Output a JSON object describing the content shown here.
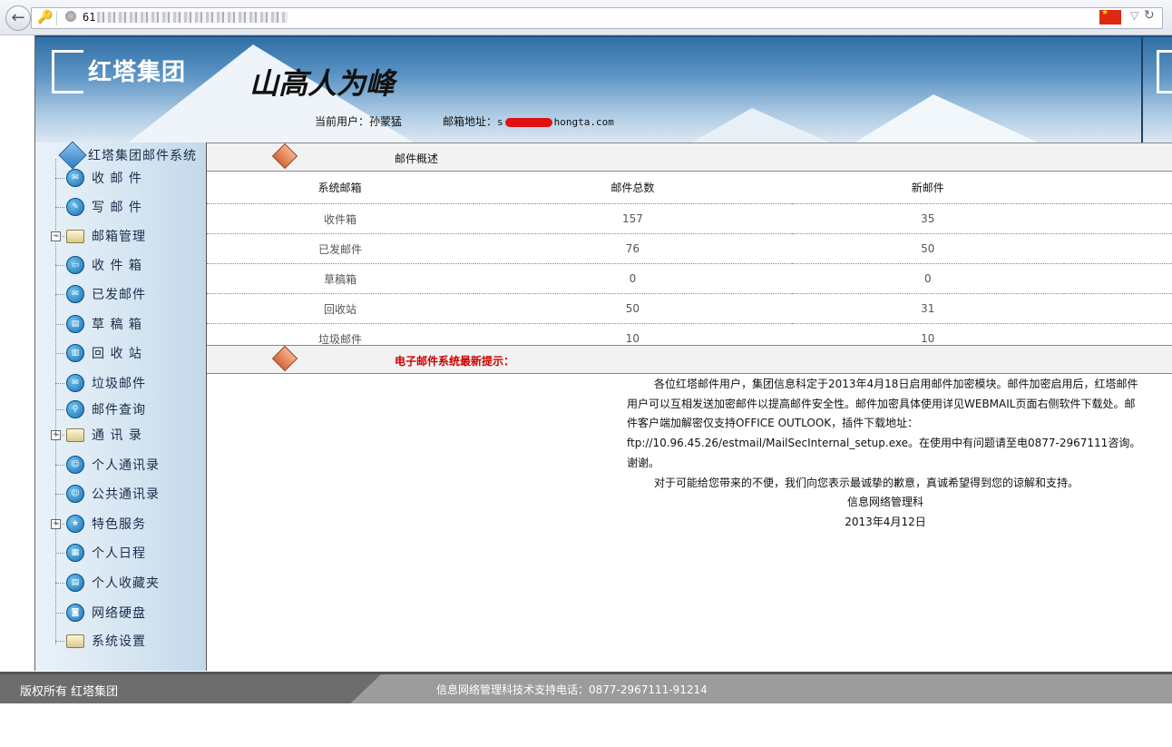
{
  "browser": {
    "back_icon": "back-arrow-icon",
    "url_prefix": "61",
    "flag": "china-flag-icon"
  },
  "header": {
    "logo_text": "红塔集团",
    "slogan": "山高人为峰",
    "current_user_label": "当前用户：",
    "current_user": "孙蒙猛",
    "mail_label": "邮箱地址：",
    "mail_prefix": "s",
    "mail_domain": "hongta.com"
  },
  "sidebar": {
    "root": "红塔集团邮件系统",
    "items": [
      {
        "label": "收 邮 件",
        "icon": "inbox-icon"
      },
      {
        "label": "写 邮 件",
        "icon": "pencil-icon"
      },
      {
        "label": "邮箱管理",
        "icon": "folder-open-icon"
      },
      {
        "label": "收 件 箱",
        "icon": "inbox-tray-icon"
      },
      {
        "label": "已发邮件",
        "icon": "sent-mail-icon"
      },
      {
        "label": "草 稿 箱",
        "icon": "draft-icon"
      },
      {
        "label": "回 收 站",
        "icon": "trash-icon"
      },
      {
        "label": "垃圾邮件",
        "icon": "spam-icon"
      },
      {
        "label": "邮件查询",
        "icon": "mail-search-icon"
      },
      {
        "label": "通 讯 录",
        "icon": "folder-icon"
      },
      {
        "label": "个人通讯录",
        "icon": "personal-contacts-icon"
      },
      {
        "label": "公共通讯录",
        "icon": "public-contacts-icon"
      },
      {
        "label": "特色服务",
        "icon": "services-icon"
      },
      {
        "label": "个人日程",
        "icon": "calendar-icon"
      },
      {
        "label": "个人收藏夹",
        "icon": "favorites-icon"
      },
      {
        "label": "网络硬盘",
        "icon": "network-disk-icon"
      },
      {
        "label": "系统设置",
        "icon": "settings-folder-icon"
      }
    ]
  },
  "overview": {
    "title": "邮件概述",
    "columns": [
      "系统邮箱",
      "邮件总数",
      "新邮件"
    ],
    "rows": [
      {
        "name": "收件箱",
        "total": "157",
        "new": "35"
      },
      {
        "name": "已发邮件",
        "total": "76",
        "new": "50"
      },
      {
        "name": "草稿箱",
        "total": "0",
        "new": "0"
      },
      {
        "name": "回收站",
        "total": "50",
        "new": "31"
      },
      {
        "name": "垃圾邮件",
        "total": "10",
        "new": "10"
      }
    ]
  },
  "notice": {
    "title": "电子邮件系统最新提示：",
    "para1": "各位红塔邮件用户，集团信息科定于2013年4月18日启用邮件加密模块。邮件加密启用后，红塔邮件用户可以互相发送加密邮件以提高邮件安全性。邮件加密具体使用详见WEBMAIL页面右侧软件下载处。邮件客户端加解密仅支持OFFICE OUTLOOK，插件下载地址：ftp://10.96.45.26/estmail/MailSecInternal_setup.exe。在使用中有问题请至电0877-2967111咨询。谢谢。",
    "para2": "对于可能给您带来的不便，我们向您表示最诚挚的歉意，真诚希望得到您的谅解和支持。",
    "signature": "信息网络管理科",
    "date": "2013年4月12日"
  },
  "footer": {
    "copyright": "版权所有   红塔集团",
    "support": "信息网络管理科技术支持电话：0877-2967111-91214"
  }
}
